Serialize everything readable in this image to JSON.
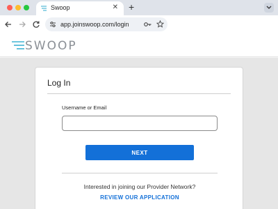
{
  "browser": {
    "tab_title": "Swoop",
    "tab_close": "✕",
    "new_tab": "+",
    "url": "app.joinswoop.com/login"
  },
  "site": {
    "logo_text": "SWOOP",
    "accent_color": "#1370d8",
    "logo_color": "#8b9096"
  },
  "login": {
    "title": "Log In",
    "username_label": "Username or Email",
    "username_value": "",
    "username_placeholder": "",
    "next_label": "NEXT",
    "promo_text": "Interested in joining our Provider Network?",
    "promo_link": "REVIEW OUR APPLICATION"
  },
  "icons": {
    "tab_favicon": "swoop-lines-icon",
    "back": "arrow-left-icon",
    "forward": "arrow-right-icon",
    "reload": "reload-icon",
    "site_info": "tune-icon",
    "password": "key-icon",
    "bookmark": "star-icon",
    "tab_menu": "chevron-down-icon"
  }
}
